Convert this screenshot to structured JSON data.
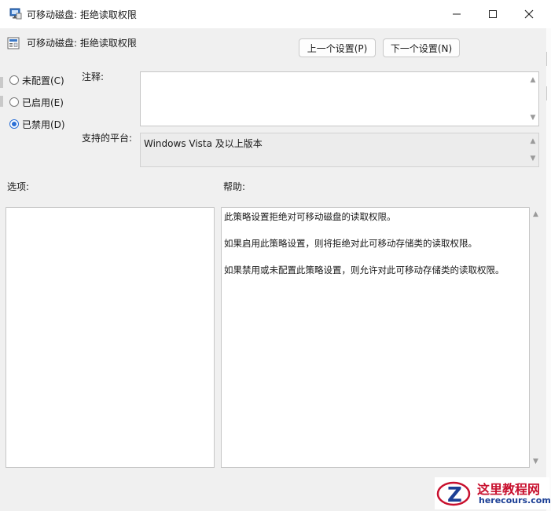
{
  "window": {
    "title": "可移动磁盘: 拒绝读取权限",
    "icons": {
      "app": "policy-window-icon",
      "minimize": "minimize-icon",
      "maximize": "maximize-icon",
      "close": "close-icon"
    }
  },
  "header": {
    "policy_name": "可移动磁盘: 拒绝读取权限",
    "prev_button": "上一个设置(P)",
    "next_button": "下一个设置(N)"
  },
  "state_options": [
    {
      "label": "未配置(C)",
      "checked": false
    },
    {
      "label": "已启用(E)",
      "checked": false
    },
    {
      "label": "已禁用(D)",
      "checked": true
    }
  ],
  "comment": {
    "label": "注释:",
    "value": ""
  },
  "platform": {
    "label": "支持的平台:",
    "value": "Windows Vista 及以上版本"
  },
  "options": {
    "label": "选项:"
  },
  "help": {
    "label": "帮助:",
    "lines": [
      "此策略设置拒绝对可移动磁盘的读取权限。",
      "如果启用此策略设置，则将拒绝对此可移动存储类的读取权限。",
      "如果禁用或未配置此策略设置，则允许对此可移动存储类的读取权限。"
    ]
  },
  "watermark": {
    "text": "这里教程网",
    "site": "herecours.com"
  },
  "colors": {
    "accent": "#2a6fd6",
    "watermark_red": "#c8102e",
    "watermark_blue": "#1c3f95"
  }
}
